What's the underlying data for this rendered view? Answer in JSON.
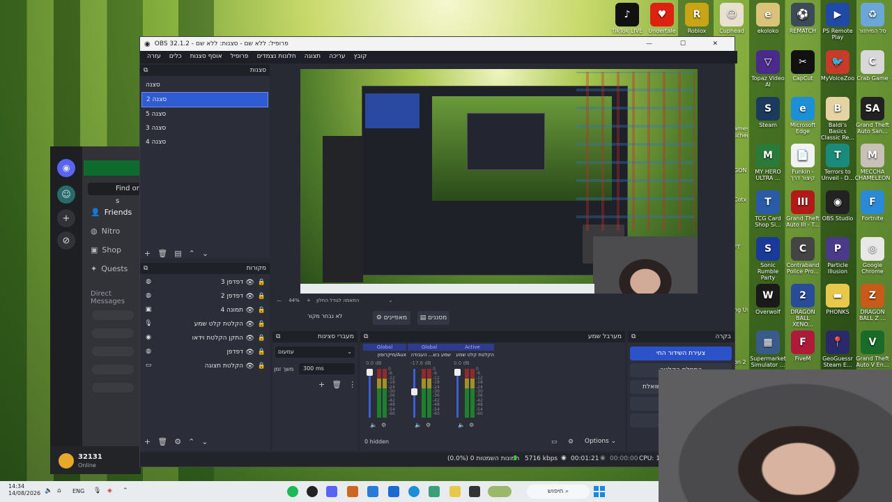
{
  "desktop_icons": [
    {
      "label": "TikTok LIVE",
      "color": "#111",
      "icon": "tiktok-icon",
      "glyph": "♪"
    },
    {
      "label": "Undertale",
      "color": "#d21",
      "icon": "heart-icon",
      "glyph": "♥"
    },
    {
      "label": "Roblox",
      "color": "#c9a515",
      "icon": "roblox-icon",
      "glyph": "R"
    },
    {
      "label": "Cuphead",
      "color": "#e9e1d0",
      "icon": "cuphead-icon",
      "glyph": "☺"
    },
    {
      "label": "ekoloko",
      "color": "#d9c27a",
      "icon": "ekoloko-icon",
      "glyph": "e"
    },
    {
      "label": "REMATCH",
      "color": "#3d4a57",
      "icon": "rematch-icon",
      "glyph": "⚽"
    },
    {
      "label": "PS Remote Play",
      "color": "#1f4aa8",
      "icon": "ps-remote-icon",
      "glyph": "▶"
    },
    {
      "label": "סל המיחזור",
      "color": "#6aa7d8",
      "icon": "recycle-bin-icon",
      "glyph": "♻"
    },
    {
      "label": "Topaz Video AI",
      "color": "#4a2a8a",
      "icon": "topaz-icon",
      "glyph": "▽"
    },
    {
      "label": "CapCut",
      "color": "#111",
      "icon": "capcut-icon",
      "glyph": "✂"
    },
    {
      "label": "MyVoiceZoo",
      "color": "#c83a2a",
      "icon": "myvoicezoo-icon",
      "glyph": "🐦"
    },
    {
      "label": "Crab Game",
      "color": "#d8d8d8",
      "icon": "crab-game-icon",
      "glyph": "C"
    },
    {
      "label": "Steam",
      "color": "#1b3a5c",
      "icon": "steam-icon",
      "glyph": "S"
    },
    {
      "label": "Microsoft Edge",
      "color": "#1c8fd8",
      "icon": "edge-icon",
      "glyph": "e"
    },
    {
      "label": "Baldi's Basics Classic Re...",
      "color": "#e6d3a3",
      "icon": "baldi-icon",
      "glyph": "B"
    },
    {
      "label": "Grand Theft Auto San...",
      "color": "#222",
      "icon": "gta-sa-icon",
      "glyph": "SA"
    },
    {
      "label": "MY HERO ULTRA ...",
      "color": "#2a7a3a",
      "icon": "my-hero-icon",
      "glyph": "M"
    },
    {
      "label": "Funkin - קיצור דרך",
      "color": "#f2f2f2",
      "icon": "funkin-icon",
      "glyph": "📄"
    },
    {
      "label": "Terrors to Unveil - D...",
      "color": "#1a8a7a",
      "icon": "terrors-icon",
      "glyph": "T"
    },
    {
      "label": "MECCHA CHAMELEON",
      "color": "#c9c0b8",
      "icon": "meccha-icon",
      "glyph": "M"
    },
    {
      "label": "TCG Card Shop Si...",
      "color": "#2a5aa8",
      "icon": "tcg-icon",
      "glyph": "T"
    },
    {
      "label": "Grand Theft Auto III - T...",
      "color": "#b21a1a",
      "icon": "gta3-icon",
      "glyph": "III"
    },
    {
      "label": "OBS Studio",
      "color": "#222",
      "icon": "obs-icon",
      "glyph": "◉"
    },
    {
      "label": "Fortnite",
      "color": "#2a8ad8",
      "icon": "fortnite-icon",
      "glyph": "F"
    },
    {
      "label": "Sonic Rumble Party",
      "color": "#1a3a9a",
      "icon": "sonic-icon",
      "glyph": "S"
    },
    {
      "label": "Contraband Police Pro...",
      "color": "#444",
      "icon": "contraband-icon",
      "glyph": "C"
    },
    {
      "label": "Particle Illusion",
      "color": "#4a3a8a",
      "icon": "particle-icon",
      "glyph": "P"
    },
    {
      "label": "Google Chrome",
      "color": "#e8e8e8",
      "icon": "chrome-icon",
      "glyph": "◎"
    },
    {
      "label": "Overwolf",
      "color": "#1a1a1a",
      "icon": "overwolf-icon",
      "glyph": "W"
    },
    {
      "label": "DRAGON BALL XENO...",
      "color": "#2a4a9a",
      "icon": "dbx-icon",
      "glyph": "2"
    },
    {
      "label": "PHONKS",
      "color": "#e8c84a",
      "icon": "folder-icon",
      "glyph": "▬"
    },
    {
      "label": "DRAGON BALL Z ...",
      "color": "#c85a1a",
      "icon": "dbz-icon",
      "glyph": "Z"
    },
    {
      "label": "Supermarket Simulator ...",
      "color": "#3a5a8a",
      "icon": "supermarket-icon",
      "glyph": "▦"
    },
    {
      "label": "FiveM",
      "color": "#b01a3a",
      "icon": "fivem-icon",
      "glyph": "F"
    },
    {
      "label": "GeoGuessr Steam E...",
      "color": "#2a2a6a",
      "icon": "geoguessr-icon",
      "glyph": "📍"
    },
    {
      "label": "Grand Theft Auto V En...",
      "color": "#1a6a2a",
      "icon": "gta5-icon",
      "glyph": "V"
    }
  ],
  "left_edge_labels": [
    "ames",
    "scher",
    "GON ULTRA",
    "Cotx",
    "FT",
    "ng Us",
    "on 2"
  ],
  "discord": {
    "find_placeholder": "Find or s",
    "nav": [
      {
        "label": "Friends",
        "icon": "friends-icon",
        "glyph": "👤"
      },
      {
        "label": "Nitro",
        "icon": "nitro-icon",
        "glyph": "◍"
      },
      {
        "label": "Shop",
        "icon": "shop-icon",
        "glyph": "▣"
      },
      {
        "label": "Quests",
        "icon": "quests-icon",
        "glyph": "✦"
      }
    ],
    "direct_messages": "Direct Messages",
    "username": "32131",
    "status": "Online"
  },
  "obs": {
    "title": "OBS 32.1.2 - פרופיל: ללא שם - סצנות: ללא שם",
    "menu": [
      "קובץ",
      "עריכה",
      "תצוגה",
      "חלונות נצמדים",
      "פרופיל",
      "אוסף סצנות",
      "כלים",
      "עזרה"
    ],
    "scenes_title": "סצנות",
    "scenes": [
      "סצנה",
      "סצנה 2",
      "סצנה 5",
      "סצנה 3",
      "סצנה 4"
    ],
    "selected_scene_index": 1,
    "sources_title": "מקורות",
    "sources": [
      {
        "label": "דפדפן 3",
        "icon": "globe-icon",
        "glyph": "◍"
      },
      {
        "label": "דפדפן 2",
        "icon": "globe-icon",
        "glyph": "◍"
      },
      {
        "label": "תמונה 4",
        "icon": "image-icon",
        "glyph": "▣"
      },
      {
        "label": "הקלטת קלט שמע",
        "icon": "microphone-icon",
        "glyph": "🎙"
      },
      {
        "label": "התקן הקלטת וידאו",
        "icon": "camera-icon",
        "glyph": "◉"
      },
      {
        "label": "דפדפן",
        "icon": "globe-icon",
        "glyph": "◍"
      },
      {
        "label": "הקלטת תצוגה",
        "icon": "monitor-icon",
        "glyph": "▭"
      }
    ],
    "preview_bar": {
      "zoom": "44%",
      "text": "התאמה לגודל החלון"
    },
    "controls": {
      "no_source": "לא נבחר מקור",
      "properties": "מאפיינים",
      "filters": "מסננים"
    },
    "transitions": {
      "title": "מעברי סצינות",
      "selected": "עמעום",
      "duration_label": "משך זמן",
      "duration_value": "300 ms"
    },
    "mixer": {
      "title": "מערבל שמע",
      "channels": [
        {
          "tag": "Global",
          "name": "Aux/מיקרופון",
          "db": "0.0 dB"
        },
        {
          "tag": "Global",
          "name": "שמע בש... העבודה",
          "db": "-17.6 dB"
        },
        {
          "tag": "Active",
          "name": "הקלטת קלט שמע",
          "db": "0.0 dB"
        }
      ],
      "scale": [
        "0",
        "-6",
        "-12",
        "-18",
        "-24",
        "-30",
        "-36",
        "-42",
        "-48",
        "-54",
        "-60"
      ],
      "hidden": "0 hidden",
      "options": "Options"
    },
    "control_panel": {
      "title": "בקרה",
      "start_stream": "צעירת השידור החי",
      "start_record": "התחלת הקלטה",
      "virtual_cam": "שואלת"
    },
    "status": {
      "dropped": "(0.0%) 0 תמונות השמטות",
      "bitrate": "5716 kbps",
      "live_time": "00:01:21",
      "rec_time": "00:00:00",
      "cpu": "CPU: 1."
    }
  },
  "taskbar": {
    "time": "14:34",
    "date": "14/08/2026",
    "lang": "ENG",
    "search": "חיפוש"
  },
  "colors": {
    "obs_bg": "#272a33",
    "selected": "#2f5bd3",
    "stream_btn": "#2c52c9"
  }
}
